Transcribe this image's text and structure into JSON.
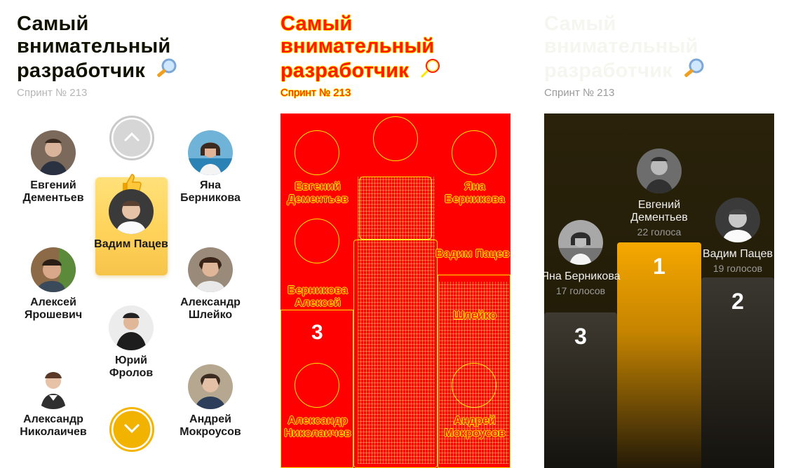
{
  "title": "Самый внимательный разработчик",
  "sprint": "Спринт № 213",
  "vote": {
    "people": [
      {
        "name": "Евгений Дементьев"
      },
      {
        "name": "Яна Берникова"
      },
      {
        "name": "Вадим Пацев"
      },
      {
        "name": "Алексей Ярошевич"
      },
      {
        "name": "Александр Шлейко"
      },
      {
        "name": "Юрий Фролов"
      },
      {
        "name": "Александр Николаичев"
      },
      {
        "name": "Андрей Мокроусов"
      }
    ],
    "selected_index": 2
  },
  "diff": {
    "labels": [
      "Евгений Дементьев",
      "Яна Берникова",
      "Вадим Пацев",
      "Берникова",
      "Алексей",
      "Шлейко",
      "Александр Николаичев",
      "Андрей Мокроусов"
    ],
    "place_number": "3"
  },
  "podium": {
    "first": {
      "place": "1",
      "name": "Евгений Дементьев",
      "votes": "22 голоса"
    },
    "second": {
      "place": "2",
      "name": "Вадим Пацев",
      "votes": "19 голосов"
    },
    "third": {
      "place": "3",
      "name": "Яна Берникова",
      "votes": "17 голосов"
    }
  },
  "colors": {
    "accent": "#f5b400",
    "selected_card": "#ffd35a",
    "dark_bg": "#221c08",
    "diff_red": "#ff0000",
    "diff_yellow": "#ffe600"
  },
  "icons": [
    "magnifier-icon",
    "thumbs-up-icon",
    "chevron-up-icon",
    "chevron-down-icon"
  ]
}
